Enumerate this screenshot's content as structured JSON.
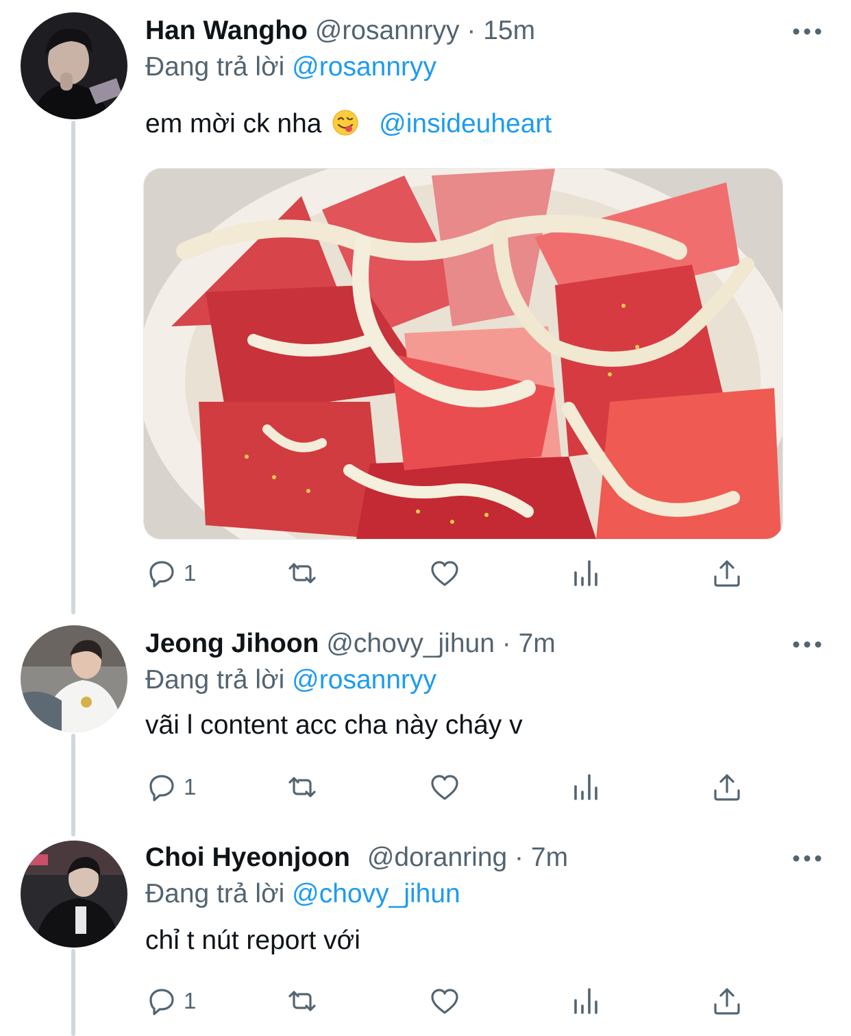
{
  "tweets": [
    {
      "name": "Han Wangho",
      "handle": "@rosannryy",
      "time": "15m",
      "replying_label": "Đang trả lời",
      "replying_to": "@rosannryy",
      "text": "em mời ck nha",
      "emoji": "face-savoring-food",
      "mention": "@insideuheart",
      "has_media": true,
      "reply_count": "1"
    },
    {
      "name": "Jeong Jihoon",
      "handle": "@chovy_jihun",
      "time": "7m",
      "replying_label": "Đang trả lời",
      "replying_to": "@rosannryy",
      "text": "vãi l content acc cha này cháy v",
      "reply_count": "1"
    },
    {
      "name": "Choi Hyeonjoon",
      "handle": "@doranring",
      "time": "7m",
      "replying_label": "Đang trả lời",
      "replying_to": "@chovy_jihun",
      "text": "chỉ t nút report với",
      "reply_count": "1"
    }
  ],
  "separator": "·",
  "icons": [
    "reply-icon",
    "retweet-icon",
    "like-icon",
    "analytics-icon",
    "share-icon",
    "more-icon"
  ],
  "colors": {
    "link": "#1d9bf0",
    "muted": "#536471",
    "text": "#0f1419",
    "thread": "#cfd9de"
  }
}
